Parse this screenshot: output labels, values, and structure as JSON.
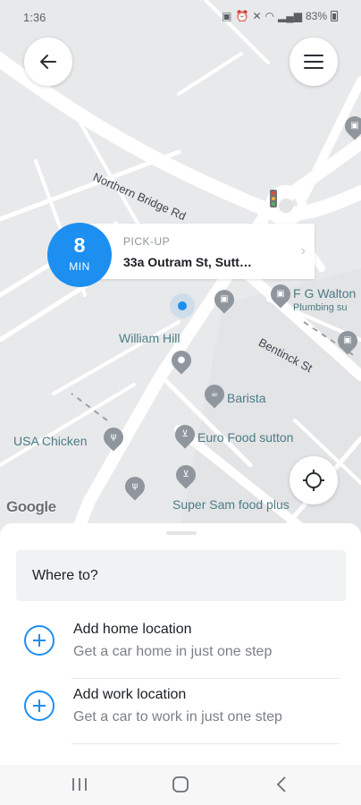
{
  "status_bar": {
    "time": "1:36",
    "battery": "83%"
  },
  "header": {
    "back_icon": "arrow-left-icon",
    "menu_icon": "hamburger-icon"
  },
  "map": {
    "streets": [
      "Northern Bridge Rd",
      "Bentinck St"
    ],
    "places": [
      "William Hill",
      "Barista",
      "Euro Food sutton",
      "USA Chicken",
      "Super Sam food plus",
      "F G Walton",
      "Plumbing su"
    ],
    "attribution": "Google"
  },
  "pickup": {
    "eta_value": "8",
    "eta_unit": "MIN",
    "label": "PICK-UP",
    "address": "33a Outram St, Sutt…",
    "chevron": "›"
  },
  "sheet": {
    "search_placeholder": "Where to?",
    "items": [
      {
        "title": "Add home location",
        "subtitle": "Get a car home in just one step"
      },
      {
        "title": "Add work location",
        "subtitle": "Get a car to work in just one step"
      }
    ]
  },
  "colors": {
    "accent": "#1d8ff0",
    "map_bg": "#e8e9eb",
    "road": "#ffffff"
  }
}
